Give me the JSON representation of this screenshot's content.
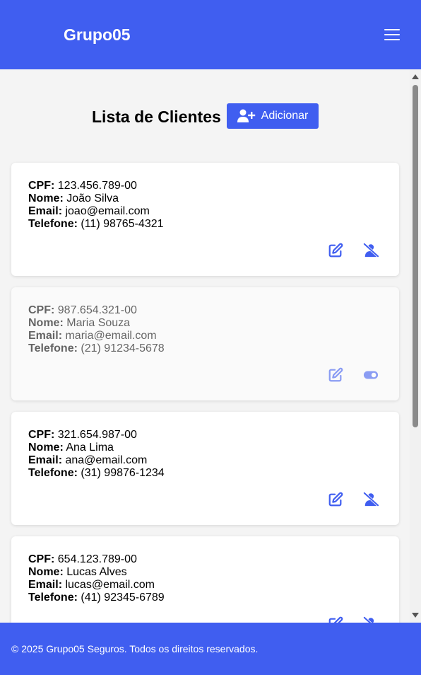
{
  "header": {
    "brand": "Grupo05",
    "menu_icon": "hamburger-menu-icon"
  },
  "main": {
    "title": "Lista de Clientes",
    "add_button": {
      "label": "Adicionar",
      "icon": "user-plus-icon"
    }
  },
  "labels": {
    "cpf": "CPF:",
    "nome": "Nome:",
    "email": "Email:",
    "telefone": "Telefone:"
  },
  "clients": [
    {
      "cpf": "123.456.789-00",
      "nome": "João Silva",
      "email": "joao@email.com",
      "telefone": "(11) 98765-4321",
      "active": true
    },
    {
      "cpf": "987.654.321-00",
      "nome": "Maria Souza",
      "email": "maria@email.com",
      "telefone": "(21) 91234-5678",
      "active": false
    },
    {
      "cpf": "321.654.987-00",
      "nome": "Ana Lima",
      "email": "ana@email.com",
      "telefone": "(31) 99876-1234",
      "active": true
    },
    {
      "cpf": "654.123.789-00",
      "nome": "Lucas Alves",
      "email": "lucas@email.com",
      "telefone": "(41) 92345-6789",
      "active": true
    }
  ],
  "footer": {
    "text": "© 2025 Grupo05 Seguros. Todos os direitos reservados."
  },
  "colors": {
    "primary": "#405ef0",
    "background": "#f4f4f4",
    "card": "#ffffff"
  }
}
